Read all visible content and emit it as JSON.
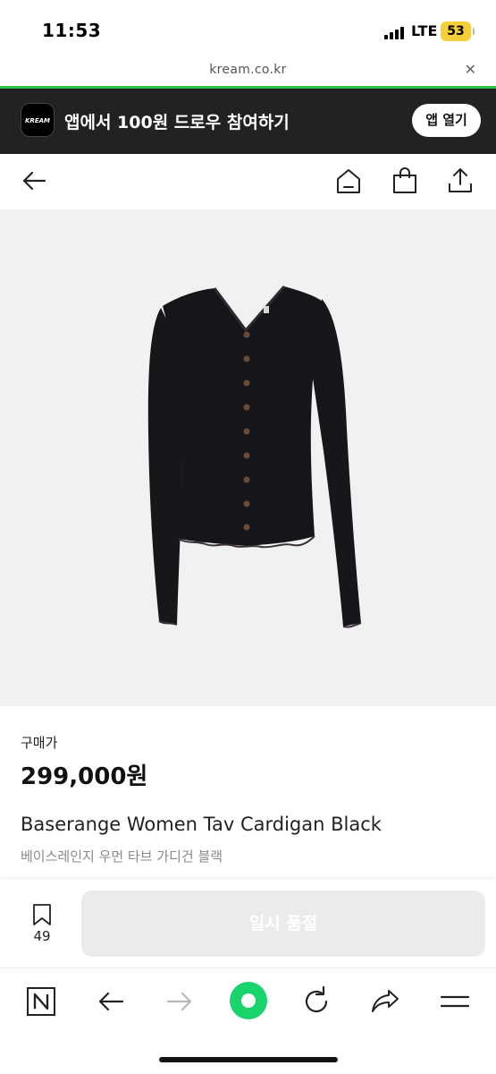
{
  "status_bar": {
    "time": "11:53",
    "network": "LTE",
    "battery": "53"
  },
  "url_bar": {
    "url": "kream.co.kr",
    "close_symbol": "✕"
  },
  "app_banner": {
    "logo_text": "KREAM",
    "text": "앱에서 100원 드로우 참여하기",
    "button_label": "앱 열기"
  },
  "header": {
    "icons": [
      "back-arrow-icon",
      "home-icon",
      "shopping-bag-icon",
      "share-icon"
    ]
  },
  "product": {
    "price_label": "구매가",
    "price": "299,000원",
    "title_en": "Baserange Women Tav Cardigan Black",
    "title_ko": "베이스레인지 우먼 타브 가디건 블랙"
  },
  "action_bar": {
    "bookmark_count": "49",
    "buy_button_label": "일시 품절"
  },
  "browser_toolbar": {
    "icons": [
      "naver-n-icon",
      "back-icon",
      "forward-icon",
      "green-dot-icon",
      "reload-icon",
      "share-icon",
      "menu-icon"
    ]
  },
  "colors": {
    "accent_green": "#2fc24a",
    "banner_bg": "#222222",
    "battery": "#f4cf3a",
    "soldout_bg": "#ebebeb"
  }
}
